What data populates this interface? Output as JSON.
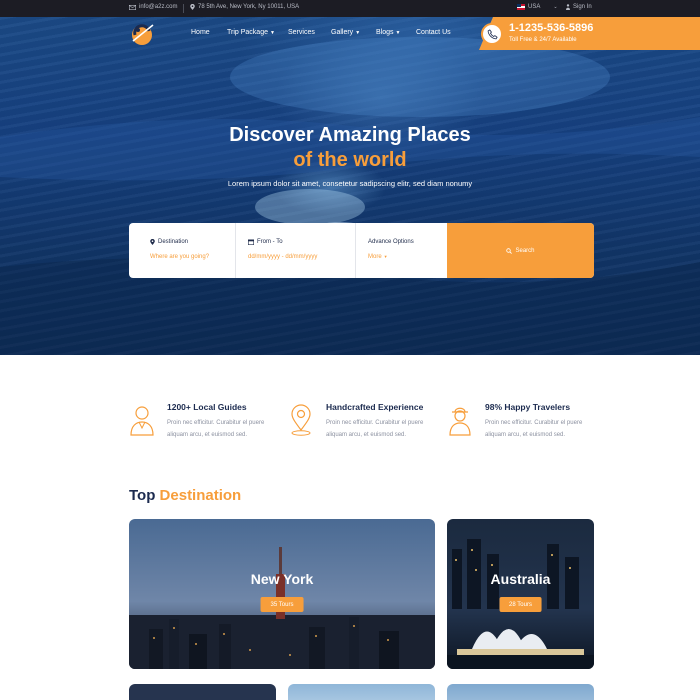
{
  "topbar": {
    "email": "info@a2z.com",
    "address": "78 5th Ave, New York, Ny 10011, USA",
    "language": "USA",
    "signin": "Sign In"
  },
  "nav": {
    "items": [
      {
        "label": "Home",
        "has_dropdown": false
      },
      {
        "label": "Trip Package",
        "has_dropdown": true
      },
      {
        "label": "Services",
        "has_dropdown": false
      },
      {
        "label": "Gallery",
        "has_dropdown": true
      },
      {
        "label": "Blogs",
        "has_dropdown": true
      },
      {
        "label": "Contact Us",
        "has_dropdown": false
      }
    ]
  },
  "contact": {
    "phone": "1-1235-536-5896",
    "subtitle": "Toll Free & 24/7 Available"
  },
  "hero": {
    "title_line1": "Discover Amazing Places",
    "title_line2": "of the world",
    "subtitle": "Lorem ipsum dolor sit amet, consetetur sadipscing elitr, sed diam nonumy"
  },
  "search": {
    "destination_label": "Destination",
    "destination_placeholder": "Where are you going?",
    "dates_label": "From - To",
    "dates_placeholder": "dd/mm/yyyy - dd/mm/yyyy",
    "advance_label": "Advance Options",
    "advance_value": "More",
    "button_label": "Search"
  },
  "features": [
    {
      "title": "1200+ Local Guides",
      "desc": "Proin nec efficitur. Curabitur el puere aliquam arcu, et euismod sed.",
      "icon": "guide-icon"
    },
    {
      "title": "Handcrafted Experience",
      "desc": "Proin nec efficitur. Curabitur el puere aliquam arcu, et euismod sed.",
      "icon": "map-pin-icon"
    },
    {
      "title": "98% Happy Travelers",
      "desc": "Proin nec efficitur. Curabitur el puere aliquam arcu, et euismod sed.",
      "icon": "traveler-icon"
    }
  ],
  "destinations": {
    "title_part1": "Top",
    "title_part2": "Destination",
    "items": [
      {
        "name": "New York",
        "tours": "35 Tours"
      },
      {
        "name": "Australia",
        "tours": "28 Tours"
      }
    ]
  },
  "colors": {
    "accent": "#f79e3b",
    "navy": "#1c2b4f",
    "topbar": "#1c1c24"
  }
}
